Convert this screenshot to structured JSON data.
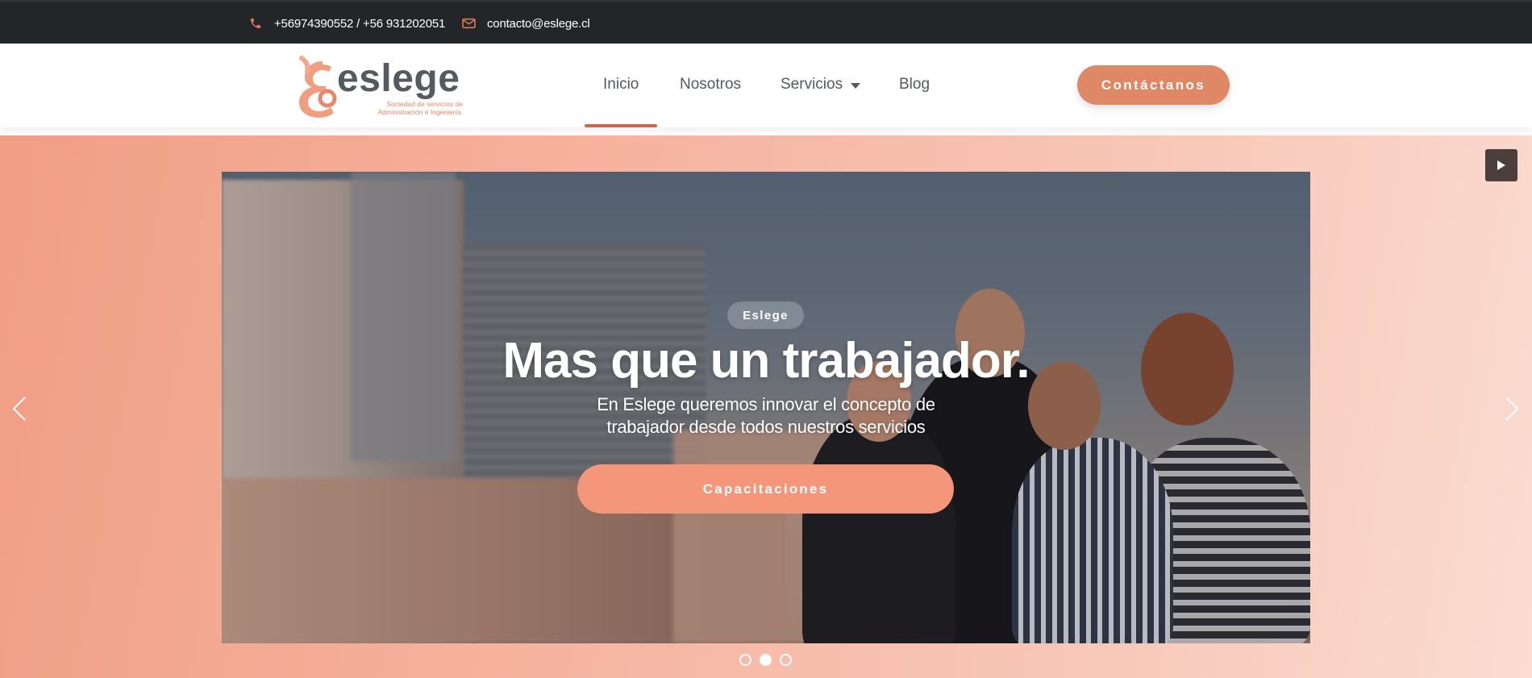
{
  "topbar": {
    "phone": "+56974390552 / +56 931202051",
    "email": "contacto@eslege.cl",
    "phone_icon": "phone-icon",
    "email_icon": "envelope-icon",
    "accent": "#e07a59"
  },
  "header": {
    "logo_word": "eslege",
    "logo_tagline_1": "Sociedad de servicios de",
    "logo_tagline_2": "Administración e Ingeniería.",
    "nav": [
      {
        "label": "Inicio",
        "active": true
      },
      {
        "label": "Nosotros",
        "active": false
      },
      {
        "label": "Servicios",
        "active": false,
        "has_dropdown": true
      },
      {
        "label": "Blog",
        "active": false
      }
    ],
    "cta_label": "Contáctanos",
    "brand_color": "#de8865"
  },
  "hero": {
    "badge": "Eslege",
    "headline": "Mas que un trabajador.",
    "subtitle_line_1": "En Eslege queremos innovar el concepto de",
    "subtitle_line_2": "trabajador desde todos nuestros servicios",
    "button_label": "Capacitaciones",
    "slides_total": 3,
    "active_slide": 2,
    "icons": {
      "prev": "chevron-left-icon",
      "next": "chevron-right-icon",
      "play": "play-icon"
    }
  }
}
